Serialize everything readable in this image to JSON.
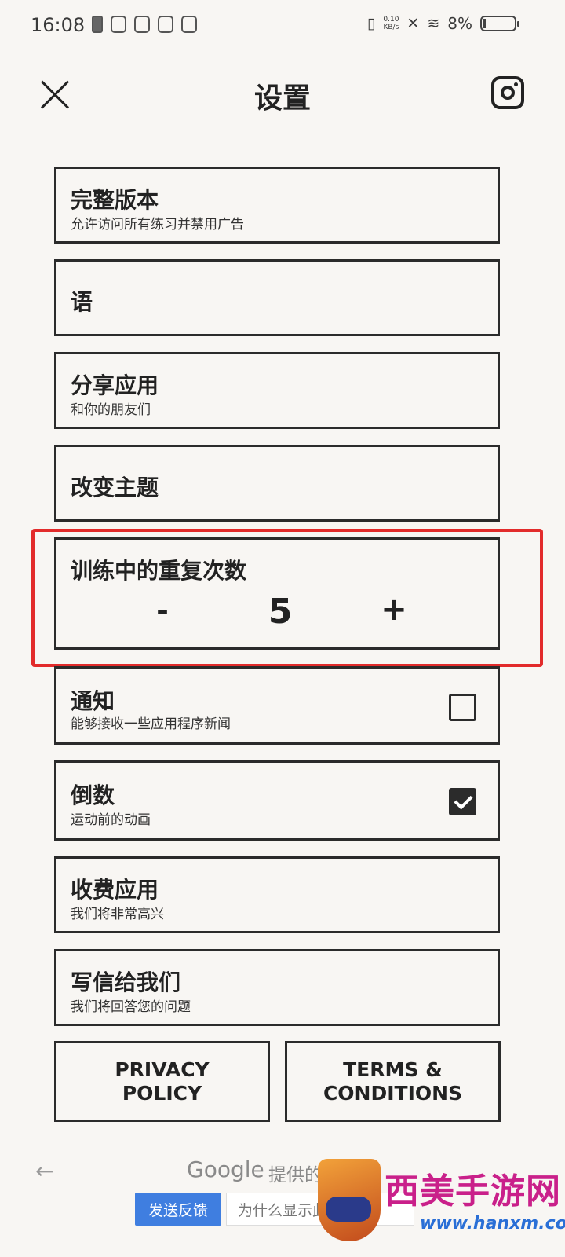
{
  "status_bar": {
    "time": "16:08",
    "net_speed_value": "0.10",
    "net_speed_unit": "KB/s",
    "battery_percent": "8%"
  },
  "header": {
    "title": "设置"
  },
  "settings": {
    "full_version": {
      "title": "完整版本",
      "subtitle": "允许访问所有练习并禁用广告"
    },
    "language": {
      "title": "语"
    },
    "share_app": {
      "title": "分享应用",
      "subtitle": "和你的朋友们"
    },
    "change_theme": {
      "title": "改变主题"
    },
    "repetitions": {
      "title": "训练中的重复次数",
      "minus": "-",
      "value": "5",
      "plus": "+"
    },
    "notifications": {
      "title": "通知",
      "subtitle": "能够接收一些应用程序新闻",
      "checked": false
    },
    "countdown": {
      "title": "倒数",
      "subtitle": "运动前的动画",
      "checked": true
    },
    "rate_app": {
      "title": "收费应用",
      "subtitle": "我们将非常高兴"
    },
    "write_us": {
      "title": "写信给我们",
      "subtitle": "我们将回答您的问题"
    }
  },
  "footer": {
    "privacy": "PRIVACY\nPOLICY",
    "terms": "TERMS &\nCONDITIONS"
  },
  "ad": {
    "back": "←",
    "google": "Google",
    "provided_by": "提供的广告",
    "feedback": "发送反馈",
    "why": "为什么显示此广告？"
  },
  "watermark": {
    "title": "西美手游网",
    "url": "www.hanxm.com"
  },
  "colors": {
    "background": "#f8f6f3",
    "border": "#2b2b2b",
    "highlight": "#e22b2b",
    "feedback_button": "#3f7ee0"
  }
}
